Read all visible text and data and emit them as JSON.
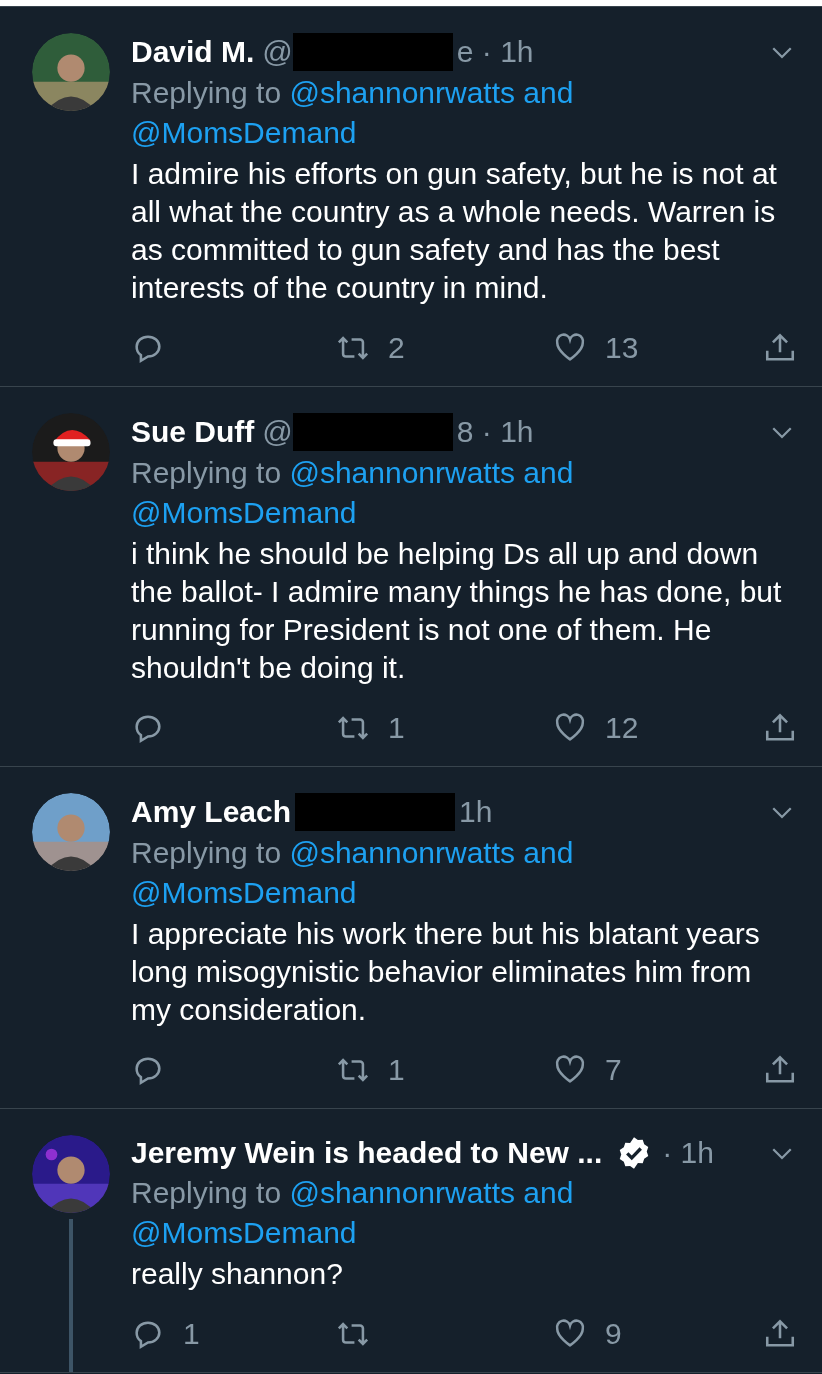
{
  "tweets": [
    {
      "name": "David M.",
      "handle_before": "@",
      "redacted": true,
      "handle_after": "e · 1h",
      "verified": false,
      "replying_label": "Replying to",
      "mentions": [
        "@shannonrwatts and",
        "@MomsDemand"
      ],
      "text": "I admire his efforts on gun safety, but he is not at all what the country as a whole needs. Warren is as committed to gun safety and has the best interests of the country in mind.",
      "retweets": "2",
      "likes": "13",
      "thread": false
    },
    {
      "name": "Sue Duff",
      "handle_before": "@",
      "redacted": true,
      "handle_after": "8 · 1h",
      "verified": false,
      "replying_label": "Replying to",
      "mentions": [
        "@shannonrwatts and",
        "@MomsDemand"
      ],
      "text": "i think he should be helping Ds all up and down the ballot- I admire many things he has done, but running for President is not one of them. He shouldn't be doing it.",
      "retweets": "1",
      "likes": "12",
      "thread": false
    },
    {
      "name": "Amy Leach",
      "redacted": true,
      "handle_after": "1h",
      "verified": false,
      "replying_label": "Replying to",
      "mentions": [
        "@shannonrwatts and",
        "@MomsDemand"
      ],
      "text": "I appreciate his work there but his blatant years long misogynistic behavior eliminates him from my consideration.",
      "retweets": "1",
      "likes": "7",
      "thread": false
    },
    {
      "name": "Jeremy Wein is headed to New ...",
      "redacted": false,
      "handle_after": "· 1h",
      "verified": true,
      "replying_label": "Replying to",
      "mentions": [
        "@shannonrwatts and",
        "@MomsDemand"
      ],
      "text": "really shannon?",
      "replies": "1",
      "likes": "9",
      "thread": true
    }
  ]
}
